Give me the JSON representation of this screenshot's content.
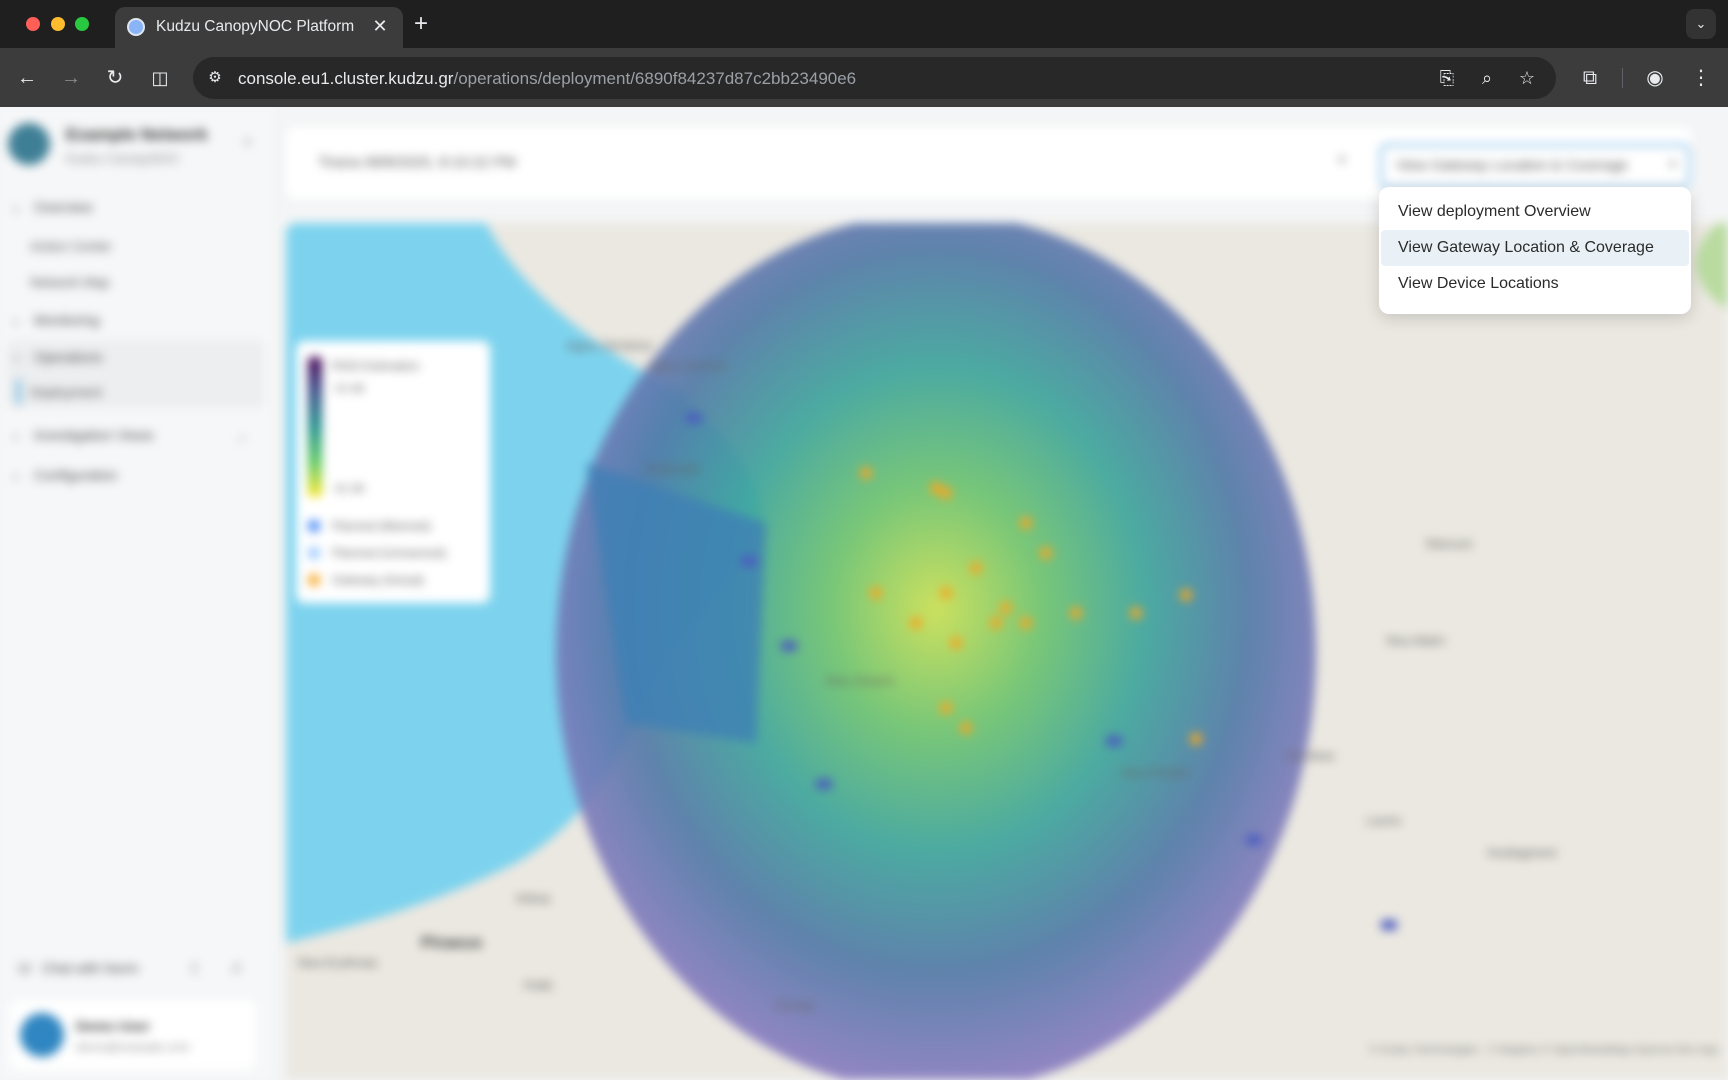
{
  "browser": {
    "tab_title": "Kudzu CanopyNOC Platform",
    "url_host": "console.eu1.cluster.kudzu.gr",
    "url_path": "/operations/deployment/6890f84237d87c2bb23490e6"
  },
  "sidebar": {
    "org_name": "Example Network",
    "org_sub": "Kudzu CanopyNOC",
    "items": [
      {
        "label": "Overview"
      },
      {
        "label": "Action Center"
      },
      {
        "label": "Network Map"
      },
      {
        "label": "Monitoring"
      },
      {
        "label": "Operations"
      },
      {
        "label": "Deployment"
      },
      {
        "label": "Investigation Views"
      },
      {
        "label": "Configuration"
      }
    ],
    "chat_label": "Chat with Norm",
    "user_name": "Demo User",
    "user_email": "demo@example.com"
  },
  "topbar": {
    "date_value": "Tirana 08/8/2025, 8:10:22 PM",
    "view_select_value": "View Gateway Location & Coverage"
  },
  "dropdown": {
    "options": [
      {
        "label": "View deployment Overview",
        "selected": false
      },
      {
        "label": "View Gateway Location & Coverage",
        "selected": true
      },
      {
        "label": "View Device Locations",
        "selected": false
      }
    ]
  },
  "legend": {
    "title": "RSSI Estimation",
    "max": "-53 dB",
    "min": "-92 dB",
    "items": [
      {
        "label": "Planned (Manned)",
        "color": "#3b82f6"
      },
      {
        "label": "Planned (Unmanned)",
        "color": "#93c5fd"
      },
      {
        "label": "Gateway (Actual)",
        "color": "#f5a623"
      }
    ]
  },
  "map": {
    "labels": [
      "Agios Dimitrios",
      "Agios Ioannis",
      "Kalamaki",
      "Nea Smyrni",
      "Piraeus",
      "Nea Erythraia",
      "Pefki",
      "Nea Penteli",
      "Marousi",
      "Lavrio",
      "Gerakas",
      "Vouliagmeni",
      "Nea Makri",
      "Koropi",
      "Kifisia"
    ],
    "attribution": "© Kudzu Technologies · © Mapbox © OpenStreetMap Improve this map"
  },
  "colors": {
    "accent": "#4aa0e0",
    "sea": "#7dd3ee",
    "land": "#ebe8e1"
  }
}
